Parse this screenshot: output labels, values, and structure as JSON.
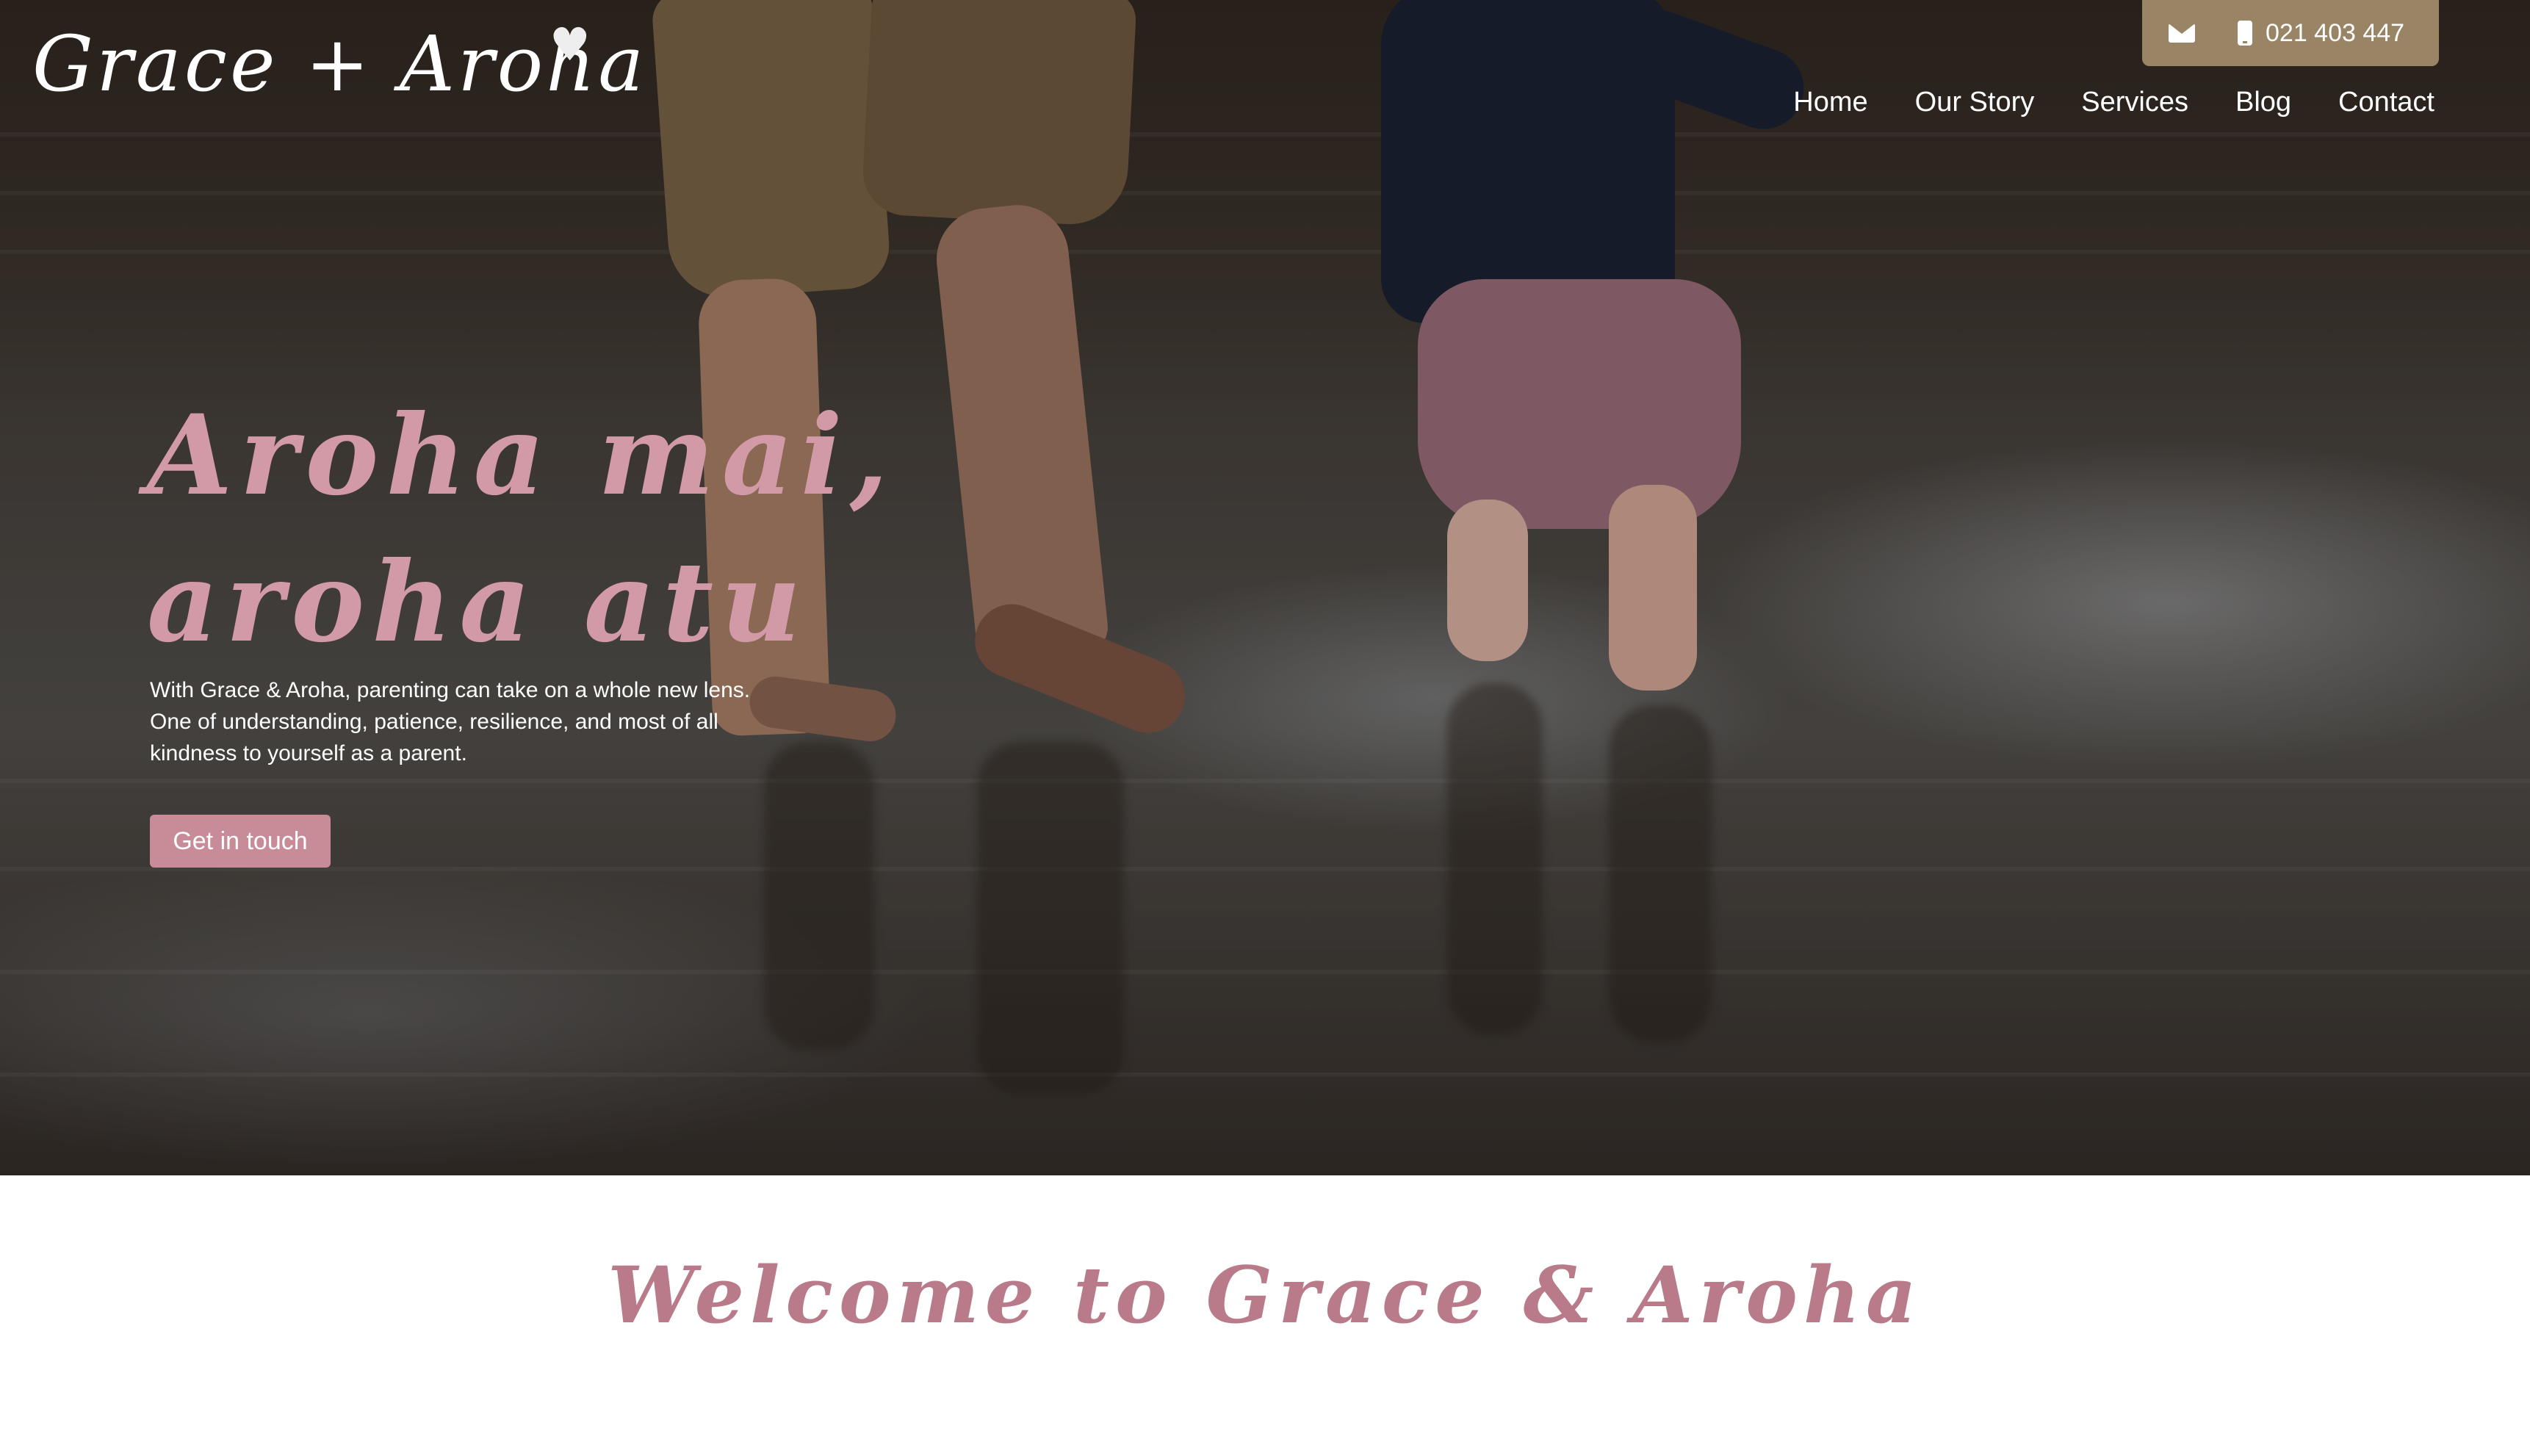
{
  "header": {
    "logo_text": "Grace + Aroha",
    "logo_heart": "♥",
    "email_icon": "envelope-icon",
    "phone_icon": "mobile-phone-icon",
    "phone": "021 403 447"
  },
  "nav": {
    "items": [
      {
        "label": "Home"
      },
      {
        "label": "Our Story"
      },
      {
        "label": "Services"
      },
      {
        "label": "Blog"
      },
      {
        "label": "Contact"
      }
    ]
  },
  "hero": {
    "headline_line1": "Aroha mai,",
    "headline_line2": "aroha atu",
    "intro": "With Grace & Aroha, parenting can take on a whole new lens. One of understanding, patience, resilience, and most of all kindness to yourself as a parent.",
    "cta_label": "Get in touch"
  },
  "welcome": {
    "title": "Welcome to Grace & Aroha"
  },
  "colors": {
    "accent_pink": "#c88c99",
    "headline_pink": "#d29aa7",
    "contact_bar": "#9a8466"
  }
}
